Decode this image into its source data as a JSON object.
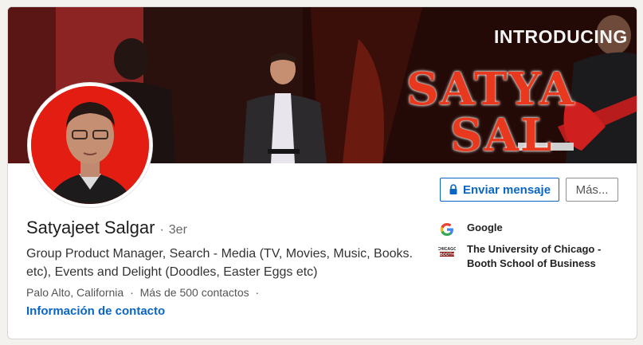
{
  "banner": {
    "intro_text": "INTRODUCING",
    "name_line1": "SATYA",
    "name_line2": "SAL"
  },
  "actions": {
    "message_label": "Enviar mensaje",
    "more_label": "Más..."
  },
  "profile": {
    "name": "Satyajeet Salgar",
    "separator": "·",
    "degree": "3er",
    "headline": "Group Product Manager, Search - Media (TV, Movies, Music, Books. etc), Events and Delight (Doodles, Easter Eggs etc)",
    "location": "Palo Alto, California",
    "dot": "·",
    "connections": "Más de 500 contactos",
    "contact_info": "Información de contacto"
  },
  "experience": [
    {
      "name": "Google",
      "logo": "google-logo"
    },
    {
      "name": "The University of Chicago - Booth School of Business",
      "logo": "chicago-booth-logo"
    }
  ],
  "colors": {
    "link": "#0a66c2",
    "avatar_bg": "#e41d12",
    "banner_title": "#e8391e"
  }
}
